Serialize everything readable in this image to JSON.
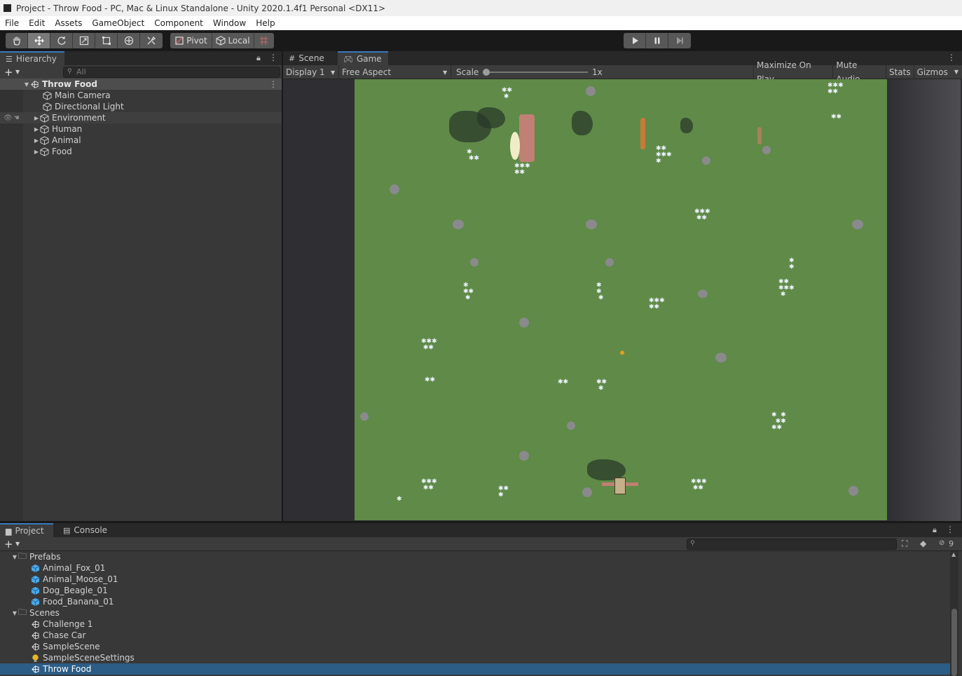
{
  "window": {
    "title": "Project - Throw Food - PC, Mac & Linux Standalone - Unity 2020.1.4f1 Personal <DX11>"
  },
  "menu": [
    "File",
    "Edit",
    "Assets",
    "GameObject",
    "Component",
    "Window",
    "Help"
  ],
  "toolbar": {
    "pivot_label": "Pivot",
    "local_label": "Local"
  },
  "hierarchy": {
    "tab_label": "Hierarchy",
    "search_placeholder": "All",
    "scene_name": "Throw Food",
    "items": [
      {
        "label": "Main Camera",
        "expandable": false
      },
      {
        "label": "Directional Light",
        "expandable": false
      },
      {
        "label": "Environment",
        "expandable": true
      },
      {
        "label": "Human",
        "expandable": true
      },
      {
        "label": "Animal",
        "expandable": true
      },
      {
        "label": "Food",
        "expandable": true
      }
    ]
  },
  "view": {
    "tabs": [
      "Scene",
      "Game"
    ],
    "active_tab": "Game",
    "display": "Display 1",
    "aspect": "Free Aspect",
    "scale_label": "Scale",
    "scale_value": "1x",
    "buttons": [
      "Maximize On Play",
      "Mute Audio",
      "Stats",
      "Gizmos"
    ]
  },
  "project": {
    "tabs": [
      "Project",
      "Console"
    ],
    "hidden_count": "9",
    "folders": [
      {
        "name": "Prefabs",
        "items": [
          "Animal_Fox_01",
          "Animal_Moose_01",
          "Dog_Beagle_01",
          "Food_Banana_01"
        ]
      },
      {
        "name": "Scenes",
        "items": [
          "Challenge 1",
          "Chase Car",
          "SampleScene",
          "SampleSceneSettings",
          "Throw Food"
        ]
      }
    ],
    "selected_item": "Throw Food"
  },
  "colors": {
    "accent": "#3a79bb",
    "selection": "#2c5d87",
    "panel": "#383838",
    "ground": "#5f8a48"
  }
}
